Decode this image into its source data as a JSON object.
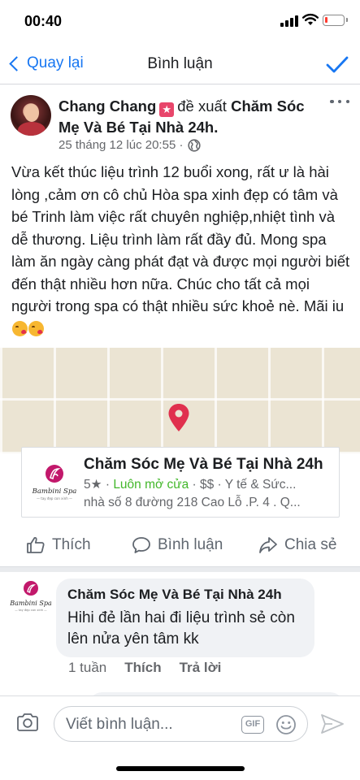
{
  "status_bar": {
    "time": "00:40",
    "battery_level": 0.15
  },
  "nav": {
    "back_label": "Quay lại",
    "title": "Bình luận"
  },
  "post": {
    "author": "Chang Chang",
    "verb": "đề xuất",
    "page_name": "Chăm Sóc Mẹ Và Bé Tại Nhà 24h.",
    "timestamp": "25 tháng 12 lúc 20:55",
    "meta_separator": "·",
    "text": "Vừa kết thúc liệu trình 12 buổi xong, rất ư là hài lòng ,cảm ơn cô chủ Hòa spa xinh đẹp có tâm và bé Trinh làm việc rất chuyên nghiệp,nhiệt tình và dễ thương. Liệu trình làm rất đầy đủ. Mong spa làm ăn ngày càng phát đạt và được mọi người biết đến thật nhiều hơn nữa. Chúc cho tất cả mọi người trong spa có thật nhiều sức khoẻ nè. Mãi iu",
    "icons": {
      "badge": "recommend-star-icon",
      "privacy": "globe-icon",
      "more": "more-icon"
    }
  },
  "place": {
    "name": "Chăm Sóc Mẹ Và Bé Tại Nhà 24h",
    "rating": "5★",
    "separator": " · ",
    "status": "Luôn mở cửa",
    "price_category": " · $$ · Y tế & Sức...",
    "address": "nhà số 8 đường 218 Cao Lỗ .P. 4 . Q...",
    "logo_text": "Bambini Spa",
    "logo_tagline": "— tay đẹp con xinh —",
    "colors": {
      "logo_accent": "#c2186b",
      "open_status": "#42b72a"
    }
  },
  "actions": {
    "like": "Thích",
    "comment": "Bình luận",
    "share": "Chia sẻ"
  },
  "comment": {
    "author": "Chăm Sóc Mẹ Và Bé Tại Nhà 24h",
    "text": "Hihi đẻ lần hai đi liệu trình sẻ còn lên nửa yên tâm kk",
    "time": "1 tuần",
    "like": "Thích",
    "reply": "Trả lời"
  },
  "composer": {
    "placeholder": "Viết bình luận...",
    "gif_label": "GIF"
  },
  "colors": {
    "accent": "#1877f2",
    "text": "#1c1e21",
    "secondary": "#65676b",
    "map_bg": "#ebe4d3",
    "pin": "#e0304e"
  }
}
